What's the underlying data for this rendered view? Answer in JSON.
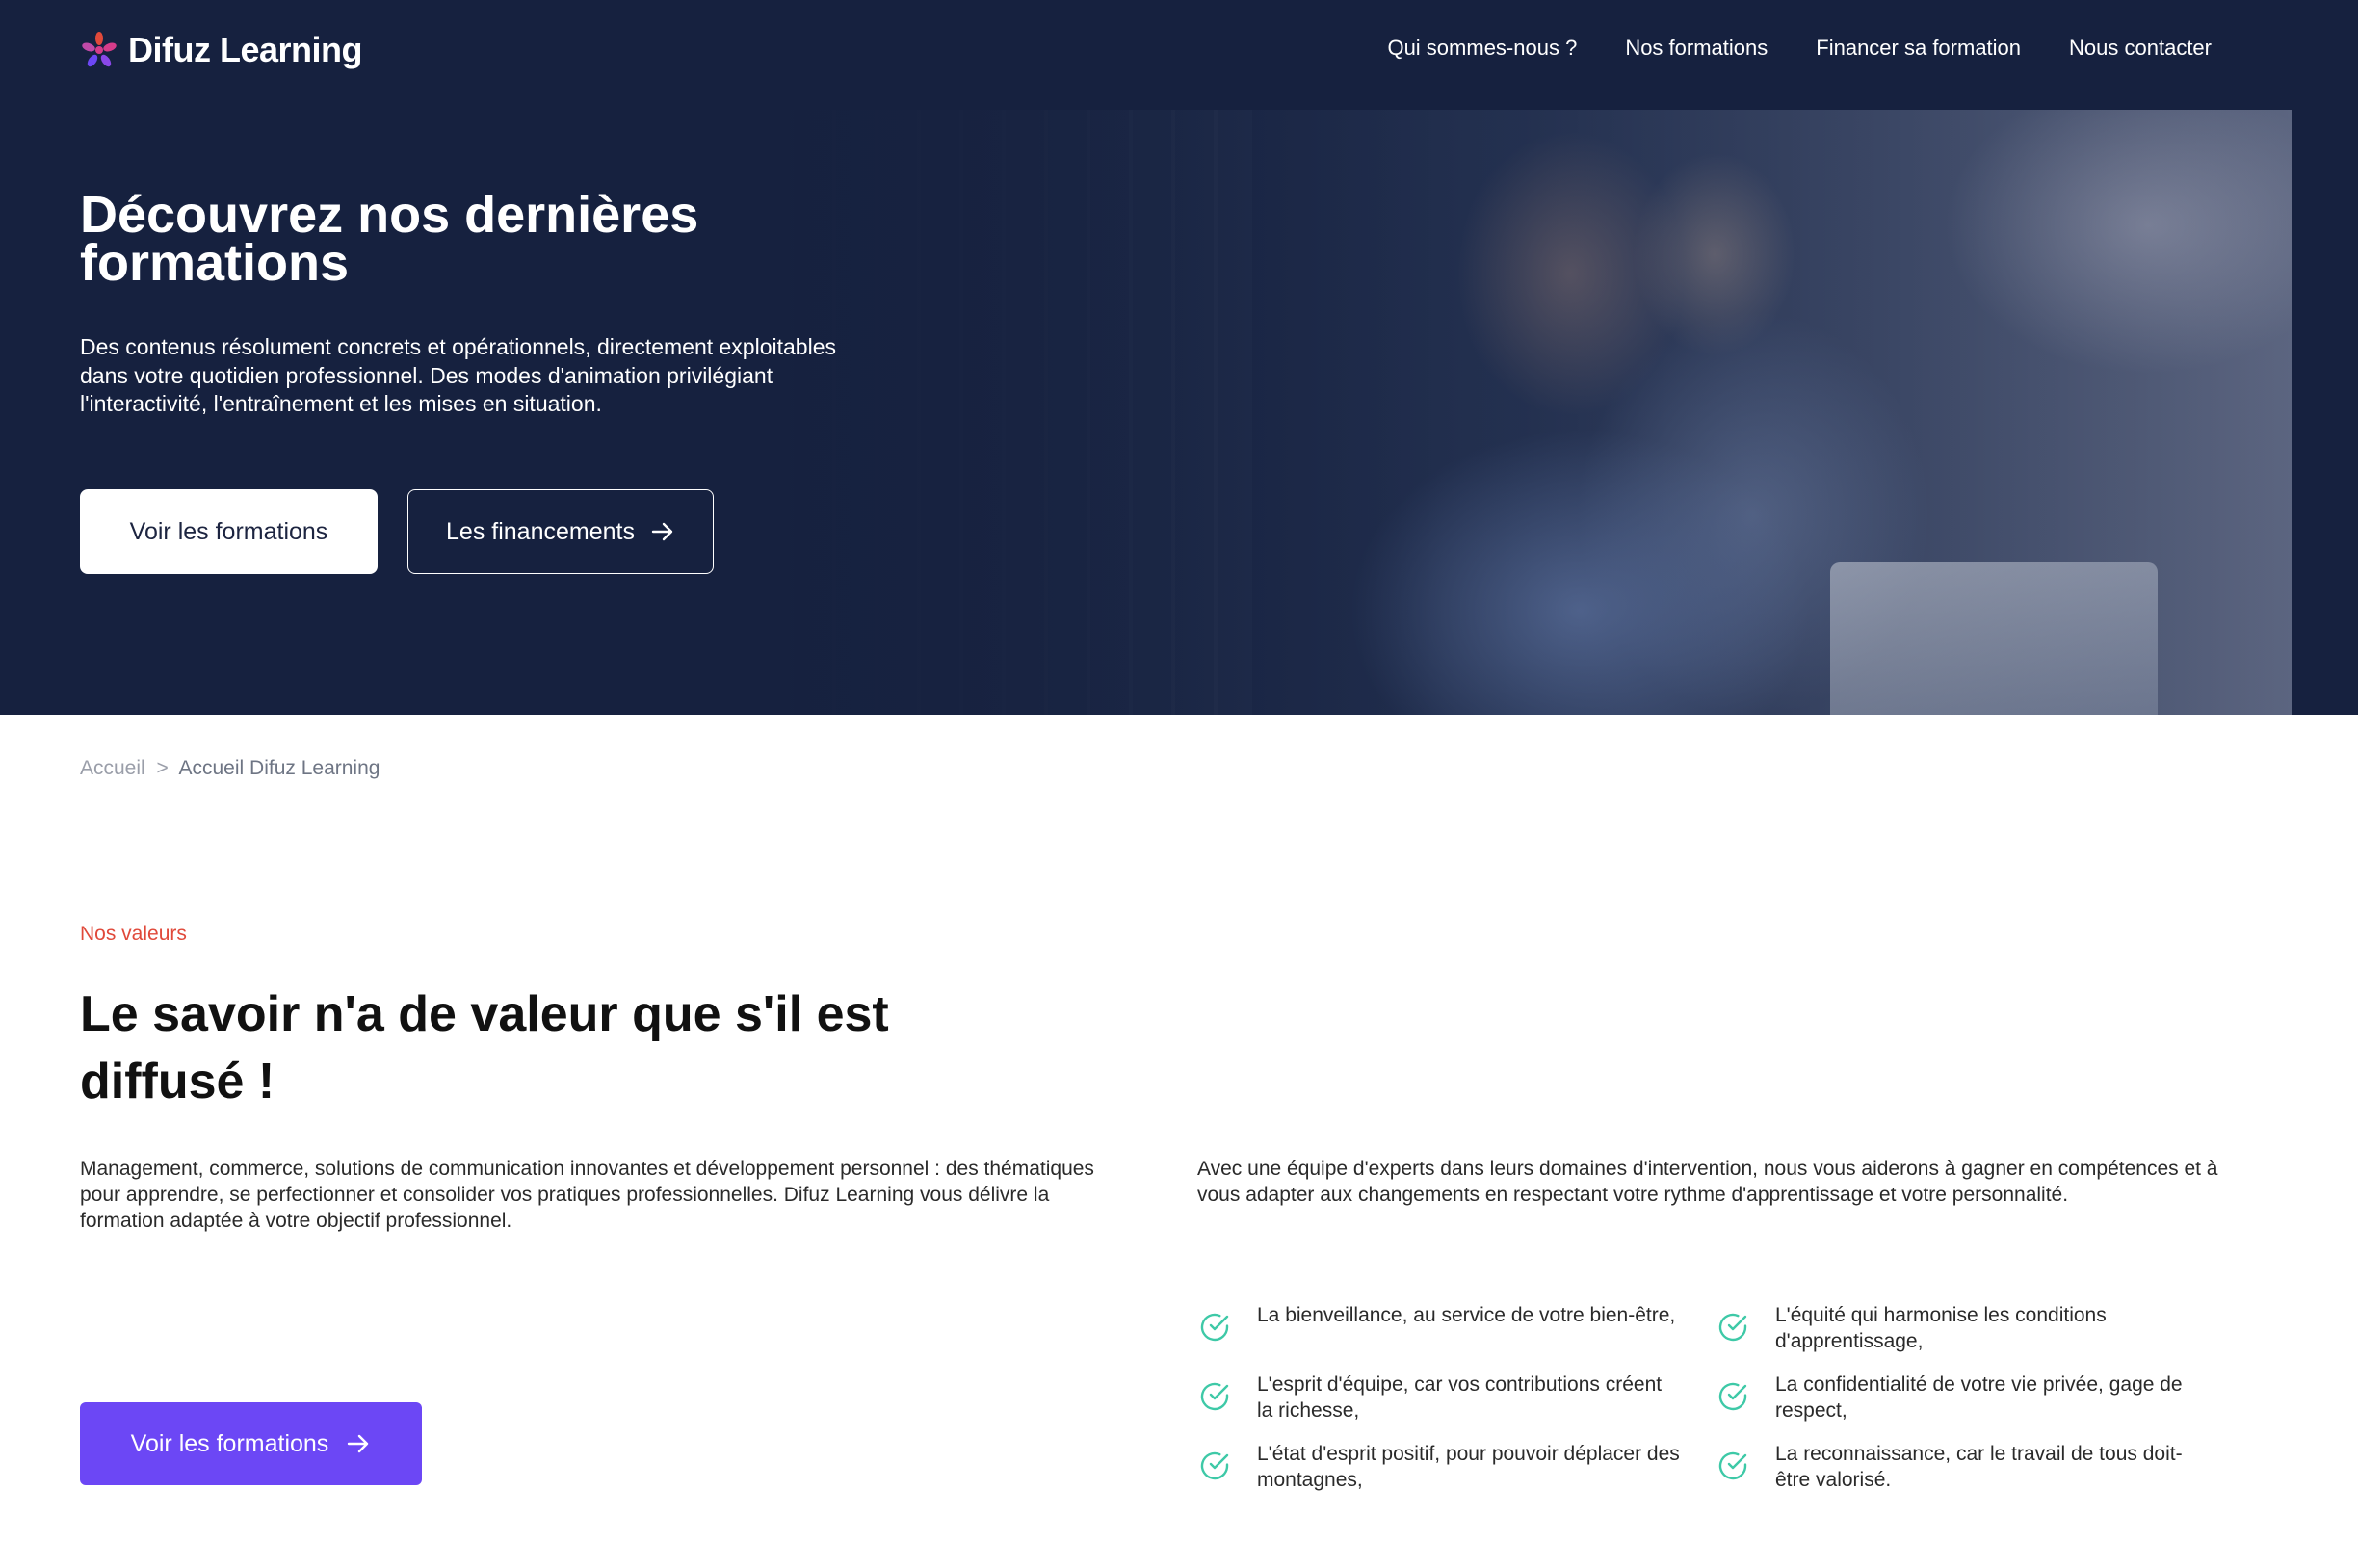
{
  "brand": {
    "name": "Difuz Learning",
    "logo_colors": [
      "#e0493a",
      "#6c47f5",
      "#d63c8a"
    ]
  },
  "nav": {
    "items": [
      {
        "label": "Qui sommes-nous ?"
      },
      {
        "label": "Nos formations"
      },
      {
        "label": "Financer sa formation"
      },
      {
        "label": "Nous contacter"
      }
    ]
  },
  "hero": {
    "title": "Découvrez nos dernières formations",
    "description": "Des contenus résolument concrets et opérationnels, directement exploitables dans votre quotidien professionnel. Des modes d'animation privilégiant l'interactivité, l'entraînement et les mises en situation.",
    "primary_button": "Voir les formations",
    "secondary_button": "Les financements",
    "secondary_icon": "arrow-right-icon"
  },
  "breadcrumb": {
    "home": "Accueil",
    "separator": ">",
    "current": "Accueil Difuz Learning"
  },
  "values": {
    "eyebrow": "Nos valeurs",
    "title": "Le savoir n'a de valeur que s'il est diffusé !",
    "description_left": "Management, commerce, solutions de communication innovantes et développement personnel : des thématiques pour apprendre, se perfectionner et consolider vos pratiques professionnelles. Difuz Learning vous délivre la formation adaptée à votre objectif professionnel.",
    "description_right": "Avec une équipe d'experts dans leurs domaines d'intervention, nous vous aiderons à gagner en compétences et à vous adapter aux changements en respectant votre rythme d'apprentissage et votre personnalité.",
    "cta": "Voir les formations",
    "check_icon": "check-circle-icon",
    "check_color": "#3ec9a7",
    "items": [
      "La bienveillance, au service de votre bien-être,",
      "L'équité qui harmonise les conditions d'apprentissage,",
      "L'esprit d'équipe, car vos contributions créent la richesse,",
      "La confidentialité de votre vie privée, gage de respect,",
      "L'état d'esprit positif, pour pouvoir déplacer des montagnes,",
      "La reconnaissance, car le travail de tous doit-être valorisé."
    ]
  },
  "colors": {
    "hero_bg": "#16213f",
    "accent_purple": "#6c47f5",
    "eyebrow_red": "#e0493a"
  }
}
